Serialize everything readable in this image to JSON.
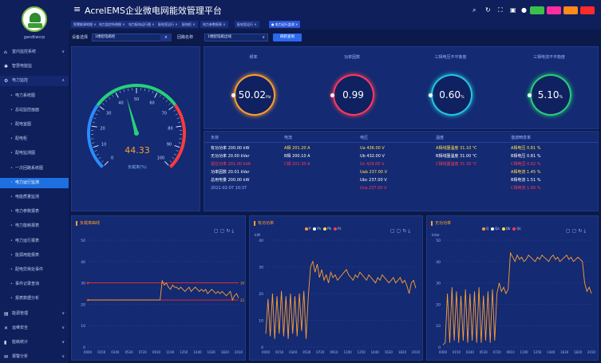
{
  "app": {
    "title": "AcrelEMS企业微电网能效管理平台",
    "username": "gandtwcrp"
  },
  "colors": {
    "bg": "#0b1a4a",
    "panel": "#142a72",
    "accent": "#1e6fe0",
    "orange": "#ff9f2f",
    "green": "#27d07a"
  },
  "header_icons": [
    "search-icon",
    "refresh-icon",
    "fullscreen-icon",
    "monitor-icon",
    "user-icon"
  ],
  "header_badges": [
    {
      "label": "",
      "color": "#3ac04a"
    },
    {
      "label": "",
      "color": "#ff2da0"
    },
    {
      "label": "",
      "color": "#ff8a1a"
    },
    {
      "label": "",
      "color": "#ff2a2a"
    }
  ],
  "sidebar": {
    "items": [
      {
        "label": "室内监控系统",
        "icon": "home-icon",
        "arrow": "∨"
      },
      {
        "label": "智慧电能监",
        "icon": "star-icon",
        "arrow": ""
      },
      {
        "label": "电力监控",
        "icon": "settings-icon",
        "arrow": "∧"
      },
      {
        "label": "电力系统图",
        "sub": true
      },
      {
        "label": "总站监控画面",
        "sub": true
      },
      {
        "label": "配电室图",
        "sub": true
      },
      {
        "label": "配电柜",
        "sub": true
      },
      {
        "label": "配电监测图",
        "sub": true
      },
      {
        "label": "一次回路系统图",
        "sub": true
      },
      {
        "label": "电力运行监测",
        "sub": true,
        "active": true
      },
      {
        "label": "电能质量监测",
        "sub": true
      },
      {
        "label": "电力参数报表",
        "sub": true
      },
      {
        "label": "电力能耗报表",
        "sub": true
      },
      {
        "label": "电力运行报表",
        "sub": true
      },
      {
        "label": "能源用能报表",
        "sub": true
      },
      {
        "label": "配电异常处事件",
        "sub": true
      },
      {
        "label": "事件记录查询",
        "sub": true
      },
      {
        "label": "报表数据分析",
        "sub": true
      },
      {
        "label": "能源管理",
        "icon": "chart-icon",
        "arrow": "∨"
      },
      {
        "label": "运维安全",
        "icon": "cross-icon",
        "arrow": "∨"
      },
      {
        "label": "能耗统计",
        "icon": "bar-icon",
        "arrow": "∨"
      },
      {
        "label": "报警分析",
        "icon": "mail-icon",
        "arrow": "∨"
      }
    ]
  },
  "tabs": [
    {
      "label": "智慧能源地图 ×"
    },
    {
      "label": "电力监控系统图 ×"
    },
    {
      "label": "电力配电运行图 ×"
    },
    {
      "label": "配电室运行 ×"
    },
    {
      "label": "配电柜 ×"
    },
    {
      "label": "电力参数报表 ×"
    },
    {
      "label": "配电室运行 ×"
    },
    {
      "label": "● 电力运行监测 ×",
      "active": true
    }
  ],
  "filter": {
    "label1": "设备选择",
    "value1": "1楼配电箱柜",
    "label2": "回路名称",
    "value2": "1楼配电箱出线",
    "button": "刷新查询"
  },
  "gauge": {
    "value": "44.33",
    "label": "负载率(%)",
    "ticks": [
      "0",
      "10",
      "20",
      "30",
      "40",
      "50",
      "60",
      "70",
      "80",
      "90",
      "100"
    ]
  },
  "kpis": [
    {
      "label": "频率",
      "value": "50.02",
      "unit": "Hz",
      "color": "#ff9f2f"
    },
    {
      "label": "功率因数",
      "value": "0.99",
      "unit": "",
      "color": "#ff3b5c"
    },
    {
      "label": "三相电压不平衡度",
      "value": "0.60",
      "unit": "%",
      "color": "#22c9e0"
    },
    {
      "label": "三相电流不平衡度",
      "value": "5.10",
      "unit": "%",
      "color": "#27d07a"
    }
  ],
  "table": {
    "headers": [
      "负荷",
      "电流",
      "电压",
      "温度",
      "谐波畸变率"
    ],
    "load": [
      {
        "text": "有功功率 200.00  kW",
        "color": "#ffffff"
      },
      {
        "text": "无功功率 20.00  kVar",
        "color": "#ffffff"
      },
      {
        "text": "视在功率 201.00  kVA",
        "color": "#ff3b5c"
      },
      {
        "text": "功率因数 20.01  kVar",
        "color": "#ffffff"
      },
      {
        "text": "总用电量 200.00  kW",
        "color": "#ffffff"
      },
      {
        "text": "2021-02-07 10:37",
        "color": "#9fb4ff"
      }
    ],
    "current": [
      {
        "text": "A相  201.20  A",
        "color": "#ffe14a"
      },
      {
        "text": "B相  200.10  A",
        "color": "#ffffff"
      },
      {
        "text": "C相  201.30  A",
        "color": "#ff3b5c"
      }
    ],
    "voltage": [
      {
        "text": "Ua  436.00  V",
        "color": "#ffe14a"
      },
      {
        "text": "Ub  432.00  V",
        "color": "#ffffff"
      },
      {
        "text": "Uc  429.00  V",
        "color": "#ff3b5c"
      },
      {
        "text": "Uab  237.00  V",
        "color": "#ffe14a"
      },
      {
        "text": "Ubc  237.00  V",
        "color": "#ffffff"
      },
      {
        "text": "Uca  237.00  V",
        "color": "#ff3b5c"
      }
    ],
    "temp": [
      {
        "text": "A相线圈温度  31.10  ℃",
        "color": "#ffe14a"
      },
      {
        "text": "B相线圈温度  31.00  ℃",
        "color": "#ffffff"
      },
      {
        "text": "C相线圈温度  31.30  ℃",
        "color": "#ff3b5c"
      }
    ],
    "thd": [
      {
        "text": "A相电压  0.81  %",
        "color": "#ffe14a"
      },
      {
        "text": "B相电压  0.81  %",
        "color": "#ffffff"
      },
      {
        "text": "C相电压  0.82  %",
        "color": "#ff3b5c"
      },
      {
        "text": "A相电流  1.45  %",
        "color": "#ffe14a"
      },
      {
        "text": "B相电流  1.51  %",
        "color": "#ffffff"
      },
      {
        "text": "C相电流  1.60  %",
        "color": "#ff3b5c"
      }
    ]
  },
  "chart_data": [
    {
      "type": "line",
      "title": "负载率曲线",
      "ylabel": "",
      "ylim": [
        0,
        50
      ],
      "yticks": [
        "0",
        "10",
        "20",
        "30",
        "40",
        "50"
      ],
      "xticks": [
        "0000",
        "0150",
        "0340",
        "0530",
        "0720",
        "0910",
        "1100",
        "1250",
        "1440",
        "1630",
        "1820",
        "2010"
      ],
      "threshold_high": 30,
      "threshold_low": 22,
      "threshold_high_label": "30",
      "threshold_low_label": "22",
      "series": [
        {
          "values": [
            22,
            22,
            22,
            22,
            22,
            22,
            22,
            22,
            22,
            22,
            22,
            22,
            22,
            22,
            22,
            22,
            22,
            22,
            22,
            22,
            22,
            22,
            22,
            22,
            22,
            22,
            22,
            22,
            22,
            22,
            22,
            22,
            22,
            22,
            22,
            22,
            31,
            29,
            30,
            28,
            27,
            29,
            28,
            28,
            27,
            28,
            27,
            26,
            27,
            28,
            26,
            27,
            28,
            27,
            26,
            27,
            26,
            27,
            25,
            26,
            27,
            26,
            25,
            26,
            25,
            26,
            25,
            24,
            25,
            26,
            22,
            24,
            25,
            23
          ]
        }
      ]
    },
    {
      "type": "line",
      "title": "有功功率",
      "ylabel": "kW",
      "ylim": [
        0,
        40
      ],
      "yticks": [
        "0",
        "10",
        "20",
        "30",
        "40"
      ],
      "xticks": [
        "0000",
        "0150",
        "0340",
        "0530",
        "0720",
        "0910",
        "1100",
        "1250",
        "1440",
        "1630",
        "1820",
        "2010"
      ],
      "legend": [
        "P",
        "Pa",
        "Pb",
        "Pc"
      ],
      "series": [
        {
          "values": [
            5,
            18,
            4,
            20,
            3,
            19,
            5,
            21,
            4,
            19,
            3,
            20,
            5,
            19,
            4,
            20,
            6,
            21,
            3,
            19,
            30,
            32,
            28,
            31,
            26,
            29,
            25,
            27,
            24,
            28,
            26,
            27,
            25,
            26,
            27,
            28,
            29,
            27,
            26,
            25,
            27,
            26,
            28,
            27,
            26,
            25,
            27,
            26,
            25,
            24,
            26,
            25,
            27,
            26,
            25,
            24,
            25,
            26,
            24,
            25,
            26,
            24,
            25,
            23,
            20,
            24,
            25,
            22
          ]
        }
      ]
    },
    {
      "type": "line",
      "title": "无功功率",
      "ylabel": "kVar",
      "ylim": [
        0,
        50
      ],
      "yticks": [
        "0",
        "10",
        "20",
        "30",
        "40",
        "50"
      ],
      "xticks": [
        "0000",
        "0150",
        "0340",
        "0530",
        "0720",
        "0910",
        "1100",
        "1250",
        "1440",
        "1630",
        "1820",
        "2010"
      ],
      "legend": [
        "Q",
        "Qa",
        "Qb",
        "Qc"
      ],
      "series": [
        {
          "values": [
            1,
            2,
            25,
            2,
            28,
            3,
            26,
            2,
            24,
            3,
            27,
            2,
            25,
            3,
            26,
            2,
            28,
            2,
            24,
            3,
            26,
            2,
            27,
            3,
            25,
            30,
            26,
            28,
            25,
            27,
            44,
            42,
            40,
            43,
            41,
            42,
            40,
            41,
            43,
            42,
            41,
            40,
            42,
            41,
            43,
            42,
            41,
            40,
            42,
            43,
            41,
            42,
            40,
            41,
            42,
            43,
            41,
            42,
            40,
            41,
            42,
            41,
            40,
            30,
            26,
            28,
            25
          ]
        }
      ]
    }
  ]
}
